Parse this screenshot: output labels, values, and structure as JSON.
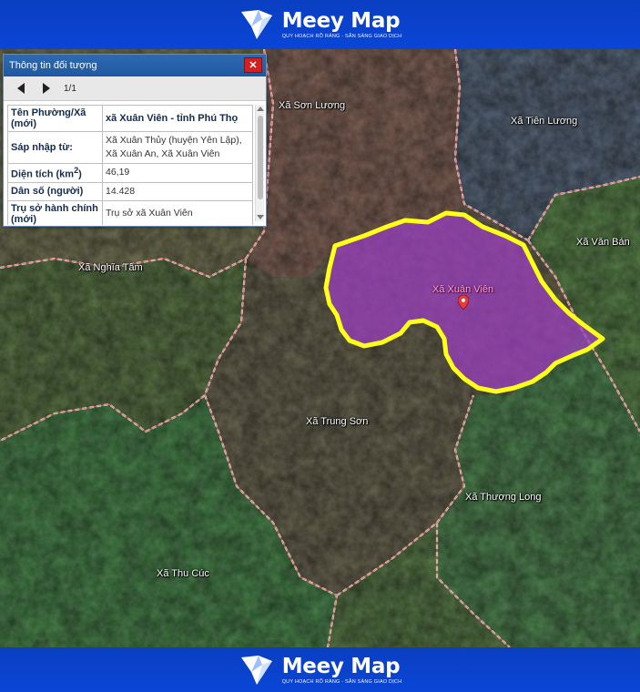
{
  "brand": {
    "name": "Meey Map",
    "tagline": "QUY HOẠCH RÕ RÀNG - SẴN SÀNG GIAO DỊCH"
  },
  "panel": {
    "title": "Thông tin đối tượng",
    "close_icon": "close-icon",
    "page_indicator": "1/1",
    "rows": [
      {
        "key": "Tên Phường/Xã (mới)",
        "value": "xã Xuân Viên - tỉnh Phú Thọ"
      },
      {
        "key": "Sáp nhập từ:",
        "value": "Xã Xuân Thủy (huyện Yên Lập), Xã Xuân An, Xã Xuân Viên"
      },
      {
        "key_prefix": "Diện tích (km",
        "key_sup": "2",
        "key_suffix": ")",
        "value": "46,19"
      },
      {
        "key": "Dân số (người)",
        "value": "14.428"
      },
      {
        "key": "Trụ sở hành chính (mới)",
        "value": "Trụ sở xã Xuân Viên"
      }
    ]
  },
  "map": {
    "highlight_color": "#ffff1a",
    "highlight_fill": "#9b3fbf",
    "boundary_color": "#e86a6a",
    "selected_commune": "Xã Xuân Viên",
    "labels": [
      {
        "id": "son-luong",
        "text": "Xã Sơn Lương"
      },
      {
        "id": "tien-luong",
        "text": "Xã Tiên Lương"
      },
      {
        "id": "van-ban",
        "text": "Xã Văn Bán"
      },
      {
        "id": "nghia-tam",
        "text": "Xã Nghĩa Tâm"
      },
      {
        "id": "xuan-vien",
        "text": "Xã Xuân Viên"
      },
      {
        "id": "trung-son",
        "text": "Xã Trung Sơn"
      },
      {
        "id": "thuong-long",
        "text": "Xã Thượng Long"
      },
      {
        "id": "thu-cuc",
        "text": "Xã Thu Cúc"
      }
    ]
  }
}
